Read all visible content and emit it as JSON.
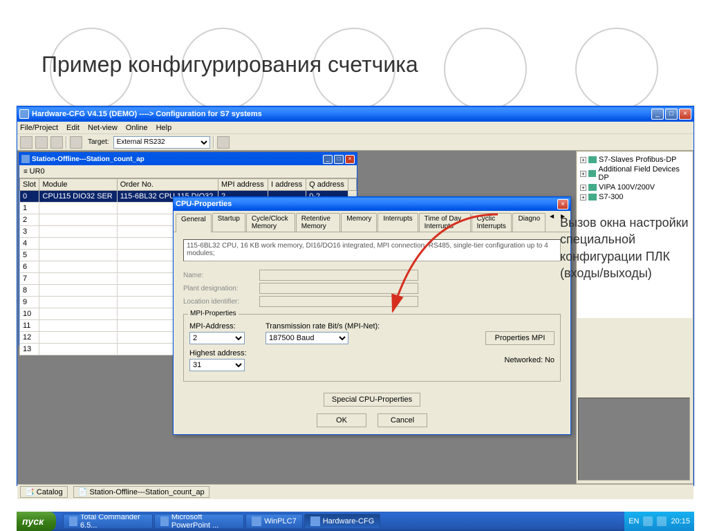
{
  "slide": {
    "title": "Пример конфигурирования счетчика"
  },
  "annotation": {
    "text": "Вызов окна настройки специальной конфигурации ПЛК (входы/выходы)"
  },
  "app": {
    "title": "Hardware-CFG V4.15 (DEMO) ----> Configuration for S7 systems",
    "menu": [
      "File/Project",
      "Edit",
      "Net-view",
      "Online",
      "Help"
    ],
    "toolbar": {
      "target_label": "Target:",
      "target_value": "External RS232"
    }
  },
  "station": {
    "title": "Station-Offline---Station_count_ap",
    "rack": "UR0",
    "headers": [
      "Slot",
      "Module",
      "Order No.",
      "MPI address",
      "I address",
      "Q address"
    ],
    "rows": [
      {
        "slot": "0",
        "module": "CPU115 DIO32 SER",
        "order": "115-6BL32 CPU 115 DIO32",
        "mpi": "2",
        "iaddr": "",
        "qaddr": "0-2",
        "sel": true
      },
      {
        "slot": "1"
      },
      {
        "slot": "2"
      },
      {
        "slot": "3"
      },
      {
        "slot": "4"
      },
      {
        "slot": "5"
      },
      {
        "slot": "6"
      },
      {
        "slot": "7"
      },
      {
        "slot": "8"
      },
      {
        "slot": "9"
      },
      {
        "slot": "10"
      },
      {
        "slot": "11"
      },
      {
        "slot": "12"
      },
      {
        "slot": "13"
      }
    ]
  },
  "dialog": {
    "title": "CPU-Properties",
    "tabs": [
      "General",
      "Startup",
      "Cycle/Clock Memory",
      "Retentive Memory",
      "Memory",
      "Interrupts",
      "Time of Day Interrupts",
      "Cyclic Interrupts",
      "Diagno"
    ],
    "desc": "115-6BL32 CPU, 16 KB work memory, DI16/DO16 integrated, MPI connection, RS485, single-tier configuration up to 4 modules;",
    "fields": {
      "name_lbl": "Name:",
      "plant_lbl": "Plant designation:",
      "loc_lbl": "Location identifier:"
    },
    "mpi": {
      "group_title": "MPI-Properties",
      "addr_lbl": "MPI-Address:",
      "addr_val": "2",
      "rate_lbl": "Transmission rate Bit/s (MPI-Net):",
      "rate_val": "187500 Baud",
      "high_lbl": "Highest address:",
      "high_val": "31",
      "props_btn": "Properties MPI",
      "networked_lbl": "Networked:",
      "networked_val": "No"
    },
    "special_btn": "Special CPU-Properties",
    "ok": "OK",
    "cancel": "Cancel"
  },
  "tree": [
    {
      "label": "S7-Slaves Profibus-DP"
    },
    {
      "label": "Additional Field Devices DP"
    },
    {
      "label": "VIPA 100V/200V"
    },
    {
      "label": "S7-300"
    }
  ],
  "statusbar": {
    "catalog": "Catalog",
    "station": "Station-Offline---Station_count_ap"
  },
  "taskbar": {
    "start": "пуск",
    "items": [
      "Total Commander 6.5...",
      "Microsoft PowerPoint ...",
      "WinPLC7",
      "Hardware-CFG"
    ],
    "lang": "EN",
    "time": "20:15"
  }
}
